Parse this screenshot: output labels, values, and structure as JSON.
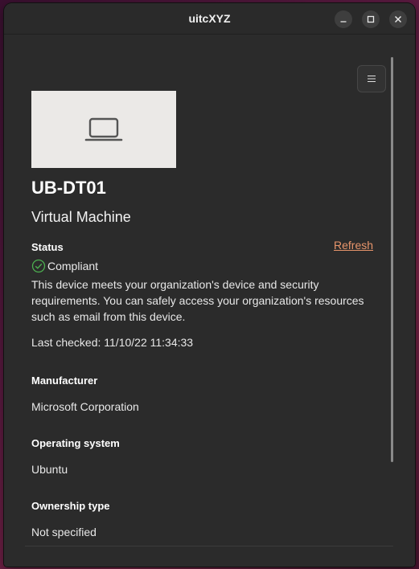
{
  "window": {
    "title": "uitcXYZ"
  },
  "device": {
    "name": "UB-DT01",
    "model": "Virtual Machine",
    "image_icon": "laptop-icon"
  },
  "status": {
    "label": "Status",
    "refresh_label": "Refresh",
    "state": "Compliant",
    "state_icon": "check-circle-icon",
    "state_color": "#4caf50",
    "description": "This device meets your organization's device and security requirements. You can safely access your organization's resources such as email from this device.",
    "last_checked": "Last checked: 11/10/22 11:34:33"
  },
  "manufacturer": {
    "label": "Manufacturer",
    "value": "Microsoft Corporation"
  },
  "operating_system": {
    "label": "Operating system",
    "value": "Ubuntu"
  },
  "ownership": {
    "label": "Ownership type",
    "value": "Not specified"
  },
  "colors": {
    "accent_link": "#e8956b",
    "window_bg": "#2b2b2b"
  }
}
